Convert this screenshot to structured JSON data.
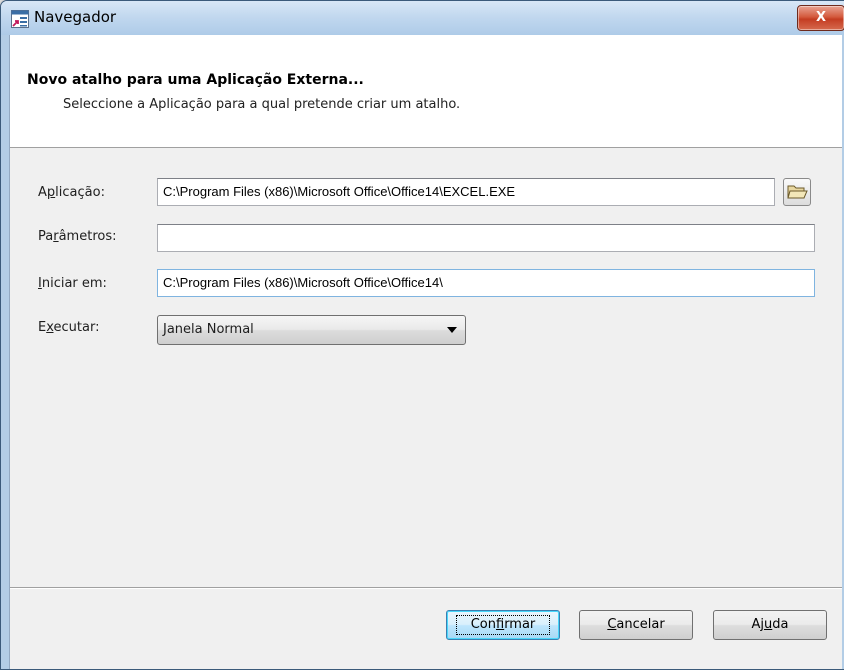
{
  "window": {
    "title": "Navegador",
    "close_glyph": "X",
    "title_icon": "app-shortcut-icon"
  },
  "header": {
    "title": "Novo atalho para uma Aplicação Externa...",
    "subtitle": "Seleccione a Aplicação para a qual pretende criar um atalho."
  },
  "form": {
    "aplicacao": {
      "label_pre": "A",
      "label_mnemonic": "p",
      "label_post": "licação:",
      "value": "C:\\Program Files (x86)\\Microsoft Office\\Office14\\EXCEL.EXE",
      "browse_icon": "folder-open-icon"
    },
    "parametros": {
      "label_pre": "Pa",
      "label_mnemonic": "r",
      "label_post": "âmetros:",
      "value": ""
    },
    "iniciar_em": {
      "label_pre": "",
      "label_mnemonic": "I",
      "label_post": "niciar em:",
      "value": "C:\\Program Files (x86)\\Microsoft Office\\Office14\\"
    },
    "executar": {
      "label_pre": "E",
      "label_mnemonic": "x",
      "label_post": "ecutar:",
      "selected": "Janela Normal"
    }
  },
  "buttons": {
    "confirm": {
      "pre": "Con",
      "mnemonic": "f",
      "post": "irmar"
    },
    "cancel": {
      "pre": "",
      "mnemonic": "C",
      "post": "ancelar"
    },
    "help": {
      "pre": "Aj",
      "mnemonic": "u",
      "post": "da"
    }
  },
  "colors": {
    "frame": "#b3cde6",
    "client": "#f0f0f0",
    "header_bg": "#ffffff",
    "close_button": "#c43d22",
    "primary_button_border": "#3c7fb1"
  }
}
